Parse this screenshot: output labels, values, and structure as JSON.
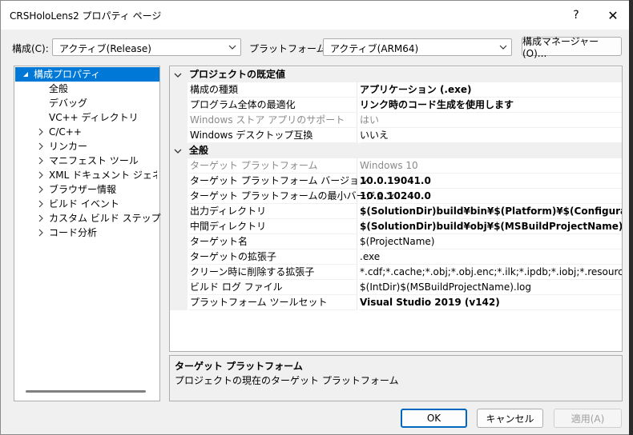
{
  "window": {
    "title": "CRSHoloLens2 プロパティ ページ",
    "help_glyph": "?",
    "close_glyph": "✕"
  },
  "toolbar": {
    "config_label": "構成(C):",
    "config_value": "アクティブ(Release)",
    "platform_label": "プラットフォーム(P):",
    "platform_value": "アクティブ(ARM64)",
    "config_manager_button": "構成マネージャー(O)..."
  },
  "tree": {
    "items": [
      {
        "label": "構成プロパティ",
        "expanded": true,
        "selected": true
      },
      {
        "label": "全般"
      },
      {
        "label": "デバッグ"
      },
      {
        "label": "VC++ ディレクトリ"
      },
      {
        "label": "C/C++",
        "collapsed": true
      },
      {
        "label": "リンカー",
        "collapsed": true
      },
      {
        "label": "マニフェスト ツール",
        "collapsed": true
      },
      {
        "label": "XML ドキュメント ジェネレーター",
        "collapsed": true
      },
      {
        "label": "ブラウザー情報",
        "collapsed": true
      },
      {
        "label": "ビルド イベント",
        "collapsed": true
      },
      {
        "label": "カスタム ビルド ステップ",
        "collapsed": true
      },
      {
        "label": "コード分析",
        "collapsed": true
      }
    ]
  },
  "grid": {
    "categories": [
      {
        "label": "プロジェクトの既定値",
        "rows": [
          {
            "name": "構成の種類",
            "value": "アプリケーション (.exe)",
            "bold": true
          },
          {
            "name": "プログラム全体の最適化",
            "value": "リンク時のコード生成を使用します",
            "bold": true
          },
          {
            "name": "Windows ストア アプリのサポート",
            "value": "はい",
            "dim": true
          },
          {
            "name": "Windows デスクトップ互換",
            "value": "いいえ"
          }
        ]
      },
      {
        "label": "全般",
        "rows": [
          {
            "name": "ターゲット プラットフォーム",
            "value": "Windows 10",
            "dim": true
          },
          {
            "name": "ターゲット プラットフォーム バージョン",
            "value": "10.0.19041.0",
            "bold": true
          },
          {
            "name": "ターゲット プラットフォームの最小バージョン",
            "value": "10.0.10240.0",
            "bold": true
          },
          {
            "name": "出力ディレクトリ",
            "value": "$(SolutionDir)build¥bin¥$(Platform)¥$(Configuration)¥",
            "bold": true
          },
          {
            "name": "中間ディレクトリ",
            "value": "$(SolutionDir)build¥obj¥$(MSBuildProjectName)¥$(Platform",
            "bold": true
          },
          {
            "name": "ターゲット名",
            "value": "$(ProjectName)"
          },
          {
            "name": "ターゲットの拡張子",
            "value": ".exe"
          },
          {
            "name": "クリーン時に削除する拡張子",
            "value": "*.cdf;*.cache;*.obj;*.obj.enc;*.ilk;*.ipdb;*.iobj;*.resources;*.tlb;*"
          },
          {
            "name": "ビルド ログ ファイル",
            "value": "$(IntDir)$(MSBuildProjectName).log"
          },
          {
            "name": "プラットフォーム ツールセット",
            "value": "Visual Studio 2019 (v142)",
            "bold": true
          }
        ]
      }
    ]
  },
  "description": {
    "title": "ターゲット プラットフォーム",
    "text": "プロジェクトの現在のターゲット プラットフォーム"
  },
  "buttons": {
    "ok": "OK",
    "cancel": "キャンセル",
    "apply": "適用(A)"
  },
  "colors": {
    "selection": "#0078d7",
    "primary_border": "#0067c0"
  }
}
